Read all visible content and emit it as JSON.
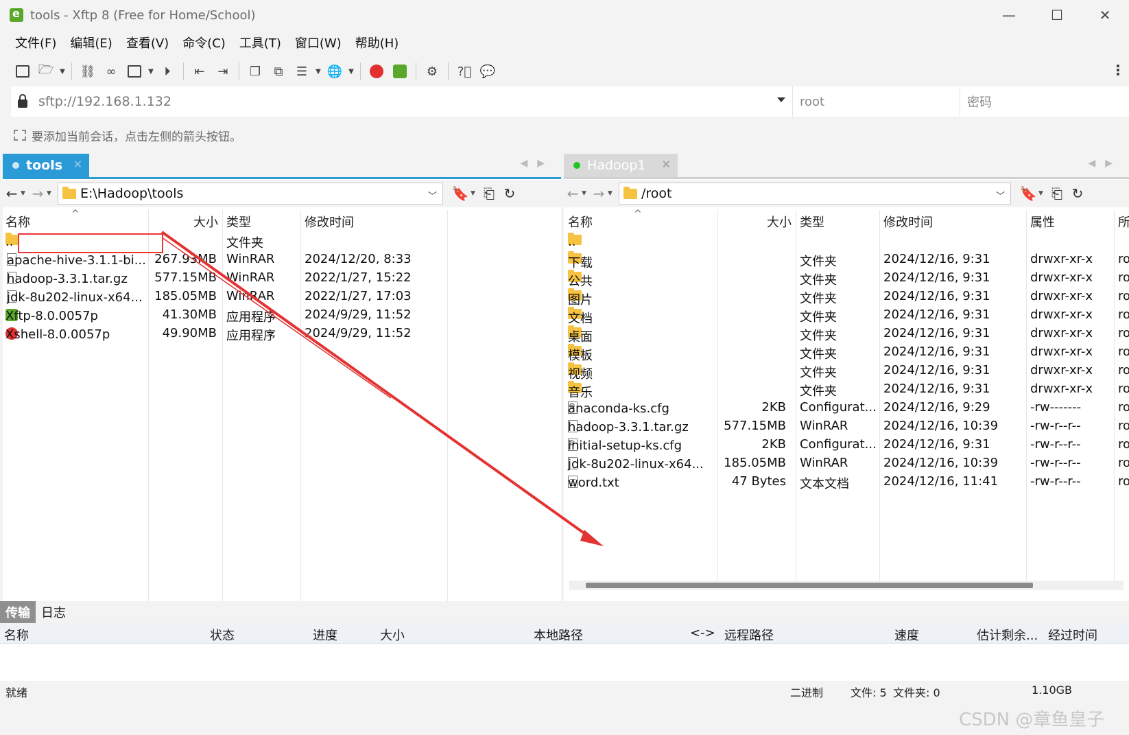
{
  "window": {
    "title": "tools - Xftp 8 (Free for Home/School)",
    "minimize": "—",
    "maximize": "☐",
    "close": "✕"
  },
  "menu": [
    "文件(F)",
    "编辑(E)",
    "查看(V)",
    "命令(C)",
    "工具(T)",
    "窗口(W)",
    "帮助(H)"
  ],
  "address": {
    "url": "sftp://192.168.1.132",
    "user": "root",
    "password_placeholder": "密码"
  },
  "hint": "要添加当前会话，点击左侧的箭头按钮。",
  "left_panel": {
    "tab": "tools",
    "path": "E:\\Hadoop\\tools",
    "columns": [
      "名称",
      "大小",
      "类型",
      "修改时间"
    ],
    "rows": [
      {
        "name": "..",
        "size": "",
        "type": "文件夹",
        "modified": "",
        "icon": "folder-icon"
      },
      {
        "name": "apache-hive-3.1.1-bi...",
        "size": "267.93MB",
        "type": "WinRAR",
        "modified": "2024/12/20, 8:33",
        "icon": "file-icon"
      },
      {
        "name": "hadoop-3.3.1.tar.gz",
        "size": "577.15MB",
        "type": "WinRAR",
        "modified": "2022/1/27, 15:22",
        "icon": "file-icon"
      },
      {
        "name": "jdk-8u202-linux-x64...",
        "size": "185.05MB",
        "type": "WinRAR",
        "modified": "2022/1/27, 17:03",
        "icon": "file-icon"
      },
      {
        "name": "Xftp-8.0.0057p",
        "size": "41.30MB",
        "type": "应用程序",
        "modified": "2024/9/29, 11:52",
        "icon": "xftp-icon"
      },
      {
        "name": "Xshell-8.0.0057p",
        "size": "49.90MB",
        "type": "应用程序",
        "modified": "2024/9/29, 11:52",
        "icon": "xshell-icon"
      }
    ]
  },
  "right_panel": {
    "tab": "Hadoop1",
    "path": "/root",
    "columns": [
      "名称",
      "大小",
      "类型",
      "修改时间",
      "属性",
      "所"
    ],
    "rows": [
      {
        "name": "..",
        "size": "",
        "type": "",
        "modified": "",
        "attr": "",
        "owner": "",
        "icon": "folder-icon"
      },
      {
        "name": "下载",
        "size": "",
        "type": "文件夹",
        "modified": "2024/12/16, 9:31",
        "attr": "drwxr-xr-x",
        "owner": "ro",
        "icon": "folder-icon"
      },
      {
        "name": "公共",
        "size": "",
        "type": "文件夹",
        "modified": "2024/12/16, 9:31",
        "attr": "drwxr-xr-x",
        "owner": "ro",
        "icon": "folder-icon"
      },
      {
        "name": "图片",
        "size": "",
        "type": "文件夹",
        "modified": "2024/12/16, 9:31",
        "attr": "drwxr-xr-x",
        "owner": "ro",
        "icon": "folder-icon"
      },
      {
        "name": "文档",
        "size": "",
        "type": "文件夹",
        "modified": "2024/12/16, 9:31",
        "attr": "drwxr-xr-x",
        "owner": "ro",
        "icon": "folder-icon"
      },
      {
        "name": "桌面",
        "size": "",
        "type": "文件夹",
        "modified": "2024/12/16, 9:31",
        "attr": "drwxr-xr-x",
        "owner": "ro",
        "icon": "folder-icon"
      },
      {
        "name": "模板",
        "size": "",
        "type": "文件夹",
        "modified": "2024/12/16, 9:31",
        "attr": "drwxr-xr-x",
        "owner": "ro",
        "icon": "folder-icon"
      },
      {
        "name": "视频",
        "size": "",
        "type": "文件夹",
        "modified": "2024/12/16, 9:31",
        "attr": "drwxr-xr-x",
        "owner": "ro",
        "icon": "folder-icon"
      },
      {
        "name": "音乐",
        "size": "",
        "type": "文件夹",
        "modified": "2024/12/16, 9:31",
        "attr": "drwxr-xr-x",
        "owner": "ro",
        "icon": "folder-icon"
      },
      {
        "name": "anaconda-ks.cfg",
        "size": "2KB",
        "type": "Configurat...",
        "modified": "2024/12/16, 9:29",
        "attr": "-rw-------",
        "owner": "ro",
        "icon": "cfg-file-icon"
      },
      {
        "name": "hadoop-3.3.1.tar.gz",
        "size": "577.15MB",
        "type": "WinRAR",
        "modified": "2024/12/16, 10:39",
        "attr": "-rw-r--r--",
        "owner": "ro",
        "icon": "file-icon"
      },
      {
        "name": "initial-setup-ks.cfg",
        "size": "2KB",
        "type": "Configurat...",
        "modified": "2024/12/16, 9:31",
        "attr": "-rw-r--r--",
        "owner": "ro",
        "icon": "cfg-file-icon"
      },
      {
        "name": "jdk-8u202-linux-x64...",
        "size": "185.05MB",
        "type": "WinRAR",
        "modified": "2024/12/16, 10:39",
        "attr": "-rw-r--r--",
        "owner": "ro",
        "icon": "file-icon"
      },
      {
        "name": "word.txt",
        "size": "47 Bytes",
        "type": "文本文档",
        "modified": "2024/12/16, 11:41",
        "attr": "-rw-r--r--",
        "owner": "ro",
        "icon": "text-file-icon"
      }
    ]
  },
  "transfer": {
    "tabs": [
      "传输",
      "日志"
    ],
    "columns": [
      "名称",
      "状态",
      "进度",
      "大小",
      "本地路径",
      "<->",
      "远程路径",
      "速度",
      "估计剩余...",
      "经过时间"
    ]
  },
  "status": {
    "ready": "就绪",
    "mode": "二进制",
    "files": "文件: 5",
    "folders": "文件夹: 0",
    "size": "1.10GB"
  },
  "watermark": "CSDN @章鱼皇子",
  "colors": {
    "active_tab": "#2b9bd8",
    "annotation": "#e33333",
    "connected_dot": "#22c322"
  }
}
